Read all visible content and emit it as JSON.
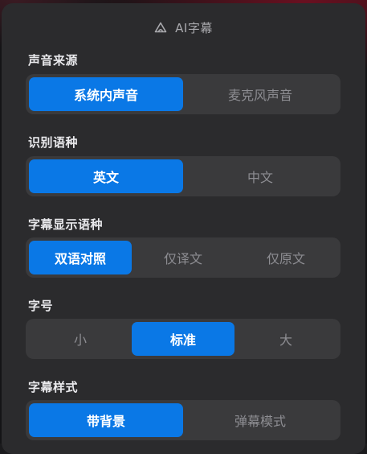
{
  "header": {
    "title": "AI字幕",
    "icon": "ai-subtitle-icon"
  },
  "accent_color": "#0a78e6",
  "sections": [
    {
      "label": "声音来源",
      "options": [
        "系统内声音",
        "麦克风声音"
      ],
      "selected": "系统内声音"
    },
    {
      "label": "识别语种",
      "options": [
        "英文",
        "中文"
      ],
      "selected": "英文"
    },
    {
      "label": "字幕显示语种",
      "options": [
        "双语对照",
        "仅译文",
        "仅原文"
      ],
      "selected": "双语对照"
    },
    {
      "label": "字号",
      "options": [
        "小",
        "标准",
        "大"
      ],
      "selected": "标准"
    },
    {
      "label": "字幕样式",
      "options": [
        "带背景",
        "弹幕模式"
      ],
      "selected": "带背景"
    }
  ]
}
